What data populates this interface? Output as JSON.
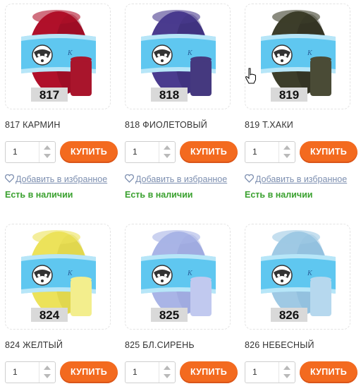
{
  "products": [
    {
      "code": "817",
      "name": "817 КАРМИН",
      "qty": "1",
      "buy_label": "КУПИТЬ",
      "fav_label": "Добавить в избранное",
      "stock_label": "Есть в наличии",
      "yarn_color": "#b0102a",
      "yarn_dark": "#7d0a1d",
      "bobbin_color": "#a9152c",
      "label_text": "K"
    },
    {
      "code": "818",
      "name": "818 ФИОЛЕТОВЫЙ",
      "qty": "1",
      "buy_label": "КУПИТЬ",
      "fav_label": "Добавить в избранное",
      "stock_label": "Есть в наличии",
      "yarn_color": "#4a3b8e",
      "yarn_dark": "#2f2466",
      "bobbin_color": "#45397f",
      "label_text": "K"
    },
    {
      "code": "819",
      "name": "819 Т.ХАКИ",
      "qty": "1",
      "buy_label": "КУПИТЬ",
      "fav_label": "Добавить в избранное",
      "stock_label": "Есть в наличии",
      "yarn_color": "#3c3d2a",
      "yarn_dark": "#24251a",
      "bobbin_color": "#4a4b36",
      "label_text": "K"
    },
    {
      "code": "824",
      "name": "824 ЖЕЛТЫЙ",
      "qty": "1",
      "buy_label": "КУПИТЬ",
      "fav_label": "",
      "stock_label": "",
      "yarn_color": "#ece25a",
      "yarn_dark": "#cfc43a",
      "bobbin_color": "#f3ee8d",
      "label_text": "K"
    },
    {
      "code": "825",
      "name": "825 БЛ.СИРЕНЬ",
      "qty": "1",
      "buy_label": "КУПИТЬ",
      "fav_label": "",
      "stock_label": "",
      "yarn_color": "#a9b4e6",
      "yarn_dark": "#8f9bd3",
      "bobbin_color": "#c1c9ef",
      "label_text": "K"
    },
    {
      "code": "826",
      "name": "826 НЕБЕСНЫЙ",
      "qty": "1",
      "buy_label": "КУПИТЬ",
      "fav_label": "",
      "stock_label": "",
      "yarn_color": "#9fc9e4",
      "yarn_dark": "#7fb2d6",
      "bobbin_color": "#b6d8ee",
      "label_text": "K"
    }
  ],
  "colors": {
    "accent": "#f36a1f",
    "stock": "#3aa12f",
    "link": "#7d8fb0",
    "band": "#5fc7f0"
  },
  "icons": [
    "heart-icon",
    "raccoon-logo-icon",
    "hand-cursor-icon",
    "arrow-up-icon",
    "arrow-down-icon"
  ]
}
